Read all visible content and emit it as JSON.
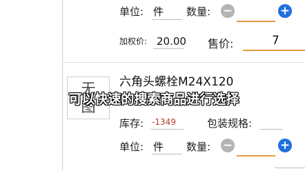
{
  "row_top": {
    "unit_label": "单位:",
    "unit_value": "件",
    "qty_label": "数量:",
    "minus_symbol": "−",
    "plus_symbol": "+",
    "weighted_price_label": "加权价:",
    "weighted_price_value": "20.00",
    "sale_price_label": "售价:",
    "sale_price_value": "7"
  },
  "product": {
    "no_image_text": "无\n图",
    "name": "六角头螺栓M24X120",
    "stock_label": "库存:",
    "stock_value": "-1349",
    "packaging_label": "包装规格:",
    "unit_label": "单位:",
    "unit_value": "件",
    "qty_label": "数量:",
    "minus_symbol": "−",
    "plus_symbol": "+"
  },
  "subtitle": "可以快速的搜索商品进行选择",
  "colors": {
    "accent_blue": "#1f6fe0",
    "minus_gray": "#b4b4b4",
    "orange_underline": "#e39b3e",
    "stock_red": "#b33a2a"
  }
}
